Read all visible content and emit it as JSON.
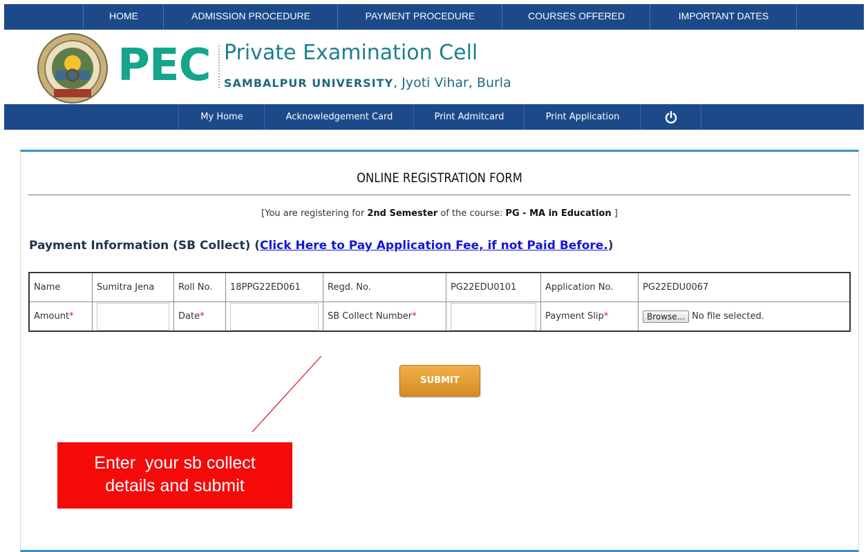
{
  "top_nav": [
    "HOME",
    "ADMISSION PROCEDURE",
    "PAYMENT PROCEDURE",
    "COURSES OFFERED",
    "IMPORTANT DATES"
  ],
  "header": {
    "brand_short": "PEC",
    "brand_title": "Private Examination Cell",
    "brand_university": "SAMBALPUR UNIVERSITY",
    "brand_location": ", Jyoti Vihar, Burla"
  },
  "sub_nav": [
    "My Home",
    "Acknowledgement Card",
    "Print Admitcard",
    "Print Application"
  ],
  "sub_nav_power_icon": "power-icon",
  "form": {
    "title": "ONLINE REGISTRATION FORM",
    "reg_prefix": "[You are registering for ",
    "semester": "2nd Semester",
    "reg_mid": " of the course: ",
    "course": "PG - MA in Education",
    "reg_suffix": " ]",
    "payment_heading": "Payment Information (SB Collect) (",
    "payment_link": "Click Here to Pay Application Fee, if not Paid Before.",
    "payment_heading_end": ")"
  },
  "table": {
    "row1": {
      "name_label": "Name",
      "name_value": "Sumitra Jena",
      "roll_label": "Roll No.",
      "roll_value": "18PPG22ED061",
      "regd_label": "Regd. No.",
      "regd_value": "PG22EDU0101",
      "app_label": "Application No.",
      "app_value": "PG22EDU0067"
    },
    "row2": {
      "amount_label": "Amount",
      "date_label": "Date",
      "sb_label": "SB Collect Number",
      "slip_label": "Payment Slip",
      "required_mark": "*",
      "browse_label": "Browse...",
      "file_status": "No file selected."
    }
  },
  "submit_label": "SUBMIT",
  "annotation": {
    "line1": "Enter  your sb collect",
    "line2": "details and submit",
    "color": "#f50a0a"
  },
  "colors": {
    "nav": "#1c4a89",
    "brand": "#15a48c",
    "accent": "#3a8fc8"
  }
}
